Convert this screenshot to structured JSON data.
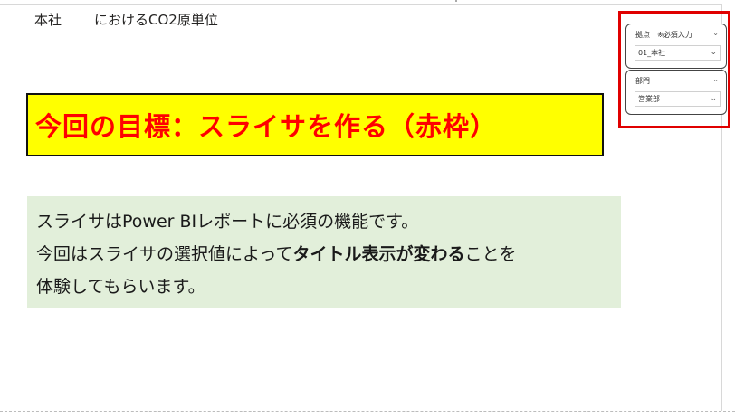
{
  "page": {
    "title_prefix": "本社",
    "title_suffix": "におけるCO2原単位"
  },
  "goal_banner": {
    "text": "今回の目標：スライサを作る（赤枠）",
    "text_color": "#ff0000",
    "background_color": "#ffff00"
  },
  "description": {
    "line1": "スライサはPower BIレポートに必須の機能です。",
    "line2_prefix": "今回はスライサの選択値によって",
    "line2_bold": "タイトル表示が変わる",
    "line2_suffix": "ことを",
    "line3": "体験してもらいます。",
    "background_color": "#e2efda"
  },
  "slicers": [
    {
      "label": "拠点　※必須入力",
      "selected": "01_本社",
      "header_chevron": "chevron-down-icon",
      "dropdown_chevron": "chevron-down-icon"
    },
    {
      "label": "部門",
      "selected": "営業部",
      "header_chevron": "chevron-down-icon",
      "dropdown_chevron": "chevron-down-icon"
    }
  ],
  "highlight_frame_color": "#e00000"
}
